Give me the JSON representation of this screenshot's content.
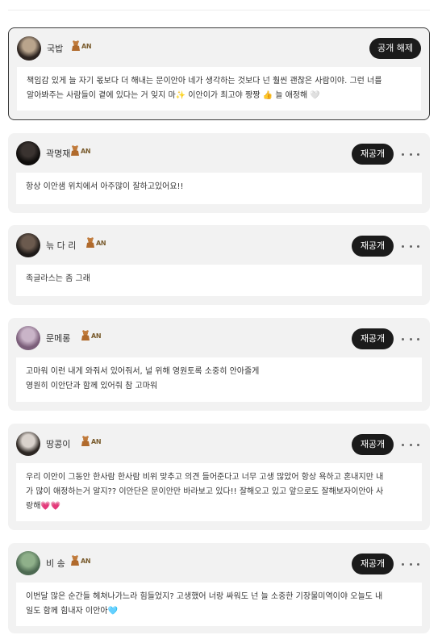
{
  "badge_text": "AN",
  "comments": [
    {
      "name": "국밥",
      "button": "공개 해제",
      "has_more": false,
      "avatar_colors": [
        "#b9a48c",
        "#2d2420"
      ],
      "text_lines": [
        "책임감 있게 늘 자기 몫보다 더 해내는 문이안아  네가 생각하는 것보다 넌 훨씬 괜찮은 사람이야.  그런 너를",
        "알아봐주는 사람들이 곁에 있다는 거 잊지 마✨  이안이가 최고야 짱짱 👍  늘 애정해 🤍"
      ]
    },
    {
      "name": "곽명재",
      "button": "재공개",
      "has_more": true,
      "avatar_colors": [
        "#3a3330",
        "#0f0d0c"
      ],
      "text_lines": [
        "항상 이안샘 위치에서 아주많이 잘하고있어요!!"
      ]
    },
    {
      "name": "늒 다 리",
      "button": "재공개",
      "has_more": true,
      "avatar_colors": [
        "#6b5a4e",
        "#1e1a18"
      ],
      "text_lines": [
        "족글라스는 좀 그래"
      ]
    },
    {
      "name": "문메롱",
      "button": "재공개",
      "has_more": true,
      "avatar_colors": [
        "#c9b4c8",
        "#7b5e7a"
      ],
      "text_lines": [
        "고마워 이런 내게 와줘서 있어줘서,                              널 위해 영원토록 소중히 안아줄게",
        "영원히 이안단과 함께 있어줘 참 고마워"
      ]
    },
    {
      "name": "땅콩이",
      "button": "재공개",
      "has_more": true,
      "avatar_colors": [
        "#d9d2cc",
        "#2c2622"
      ],
      "text_lines": [
        "우리 이안이 그동안 한사람 한사람 비위 맞추고 의견 들어준다고 너무 고생 많았어 항상 욕하고 혼내지만 내",
        "가 많이 애정하는거 알지?? 이안단은 문이안만 바라보고 있다!! 잘해오고 있고 앞으로도 잘해보자이안아 사",
        "랑해💗💗"
      ]
    },
    {
      "name": "비 송",
      "button": "재공개",
      "has_more": true,
      "avatar_colors": [
        "#8fb08a",
        "#4d6a52"
      ],
      "text_lines": [
        "이번달 많은 순간들 헤쳐나가느라 힘들었지? 고생했어 너랑 싸워도 넌 늘 소중한 기장물미역이야 오늘도 내",
        "일도 함께 힘내자 이안아🩵"
      ]
    }
  ]
}
